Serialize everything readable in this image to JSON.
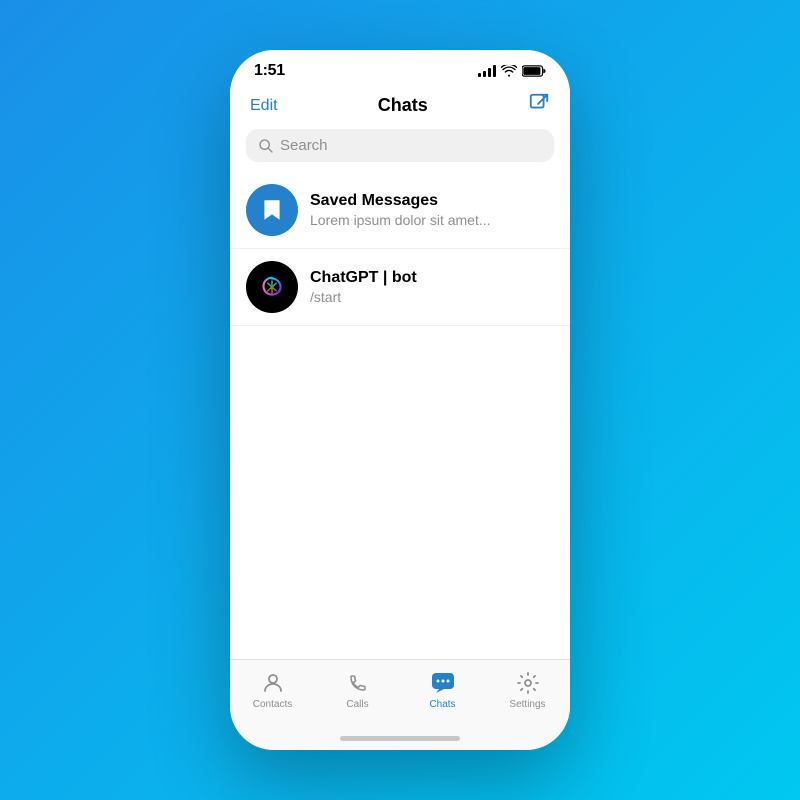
{
  "status": {
    "time": "1:51",
    "signal": [
      3,
      5,
      8,
      11,
      14
    ],
    "wifi": "wifi",
    "battery": "battery"
  },
  "header": {
    "edit_label": "Edit",
    "title": "Chats",
    "compose_label": "compose"
  },
  "search": {
    "placeholder": "Search"
  },
  "chats": [
    {
      "id": "saved-messages",
      "name": "Saved Messages",
      "preview": "Lorem ipsum dolor sit amet...",
      "avatar_type": "saved"
    },
    {
      "id": "chatgpt-bot",
      "name": "ChatGPT | bot",
      "preview": "/start",
      "avatar_type": "chatgpt"
    }
  ],
  "tabs": [
    {
      "id": "contacts",
      "label": "Contacts",
      "active": false
    },
    {
      "id": "calls",
      "label": "Calls",
      "active": false
    },
    {
      "id": "chats",
      "label": "Chats",
      "active": true
    },
    {
      "id": "settings",
      "label": "Settings",
      "active": false
    }
  ],
  "colors": {
    "accent": "#2481cc",
    "inactive_tab": "#8e8e93",
    "active_tab": "#2481cc"
  }
}
